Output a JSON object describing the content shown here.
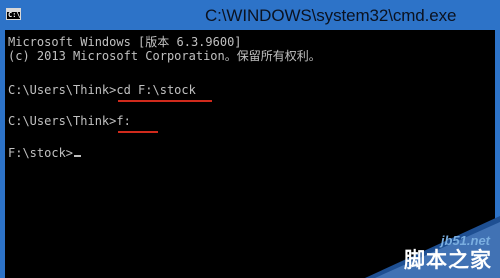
{
  "window": {
    "title": "C:\\WINDOWS\\system32\\cmd.exe",
    "icon": "command-prompt-icon",
    "colors": {
      "titlebar": "#2d73c8",
      "console_bg": "#000000",
      "console_text": "#c0c0c0",
      "annotation": "#d02a1c"
    }
  },
  "console": {
    "lines": [
      "Microsoft Windows [版本 6.3.9600]",
      "(c) 2013 Microsoft Corporation。保留所有权利。",
      "C:\\Users\\Think>cd F:\\stock",
      "C:\\Users\\Think>f:",
      "F:\\stock>"
    ]
  },
  "watermark": {
    "site": "jb51.net",
    "name": "脚本之家"
  }
}
